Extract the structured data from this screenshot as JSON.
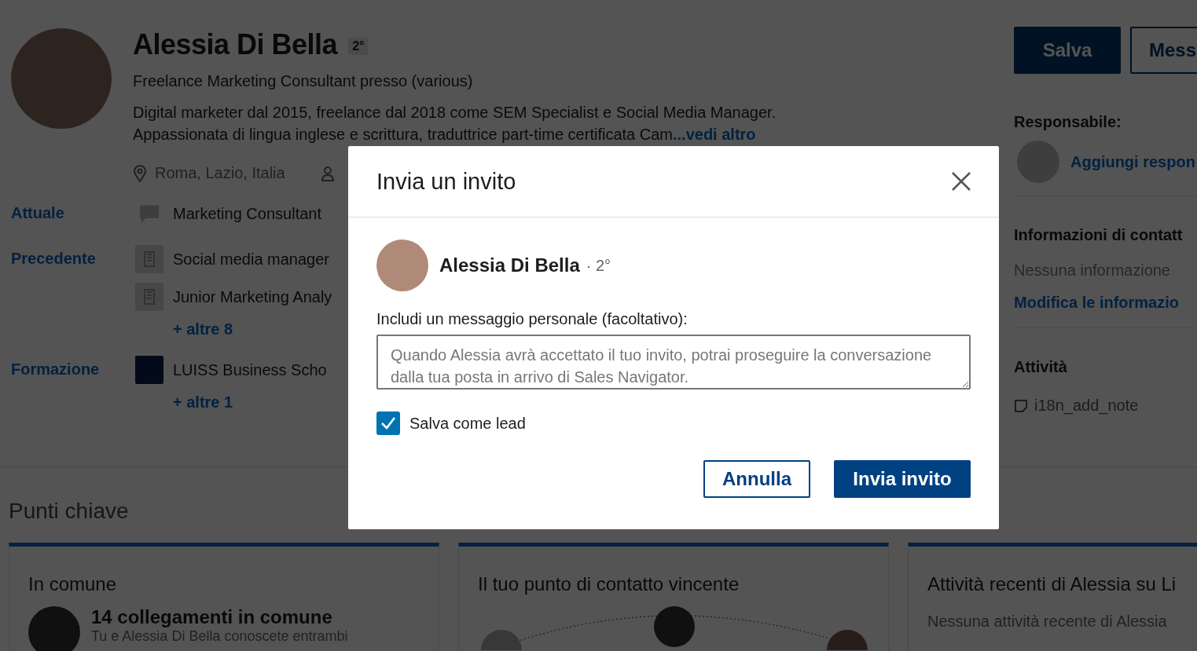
{
  "profile": {
    "name": "Alessia Di Bella",
    "degree": "2°",
    "headline": "Freelance Marketing Consultant presso (various)",
    "summary": [
      "Digital marketer dal 2015, freelance dal 2018 come SEM Specialist e Social Media Manager.",
      "Appassionata di lingua inglese e scrittura, traduttrice part-time certificata Cam"
    ],
    "summary_link": "...vedi altro",
    "location": "Roma, Lazio, Italia",
    "sections": [
      {
        "label": "Attuale",
        "entries": [
          {
            "kind": "bubble",
            "text": "Marketing Consultant"
          }
        ]
      },
      {
        "label": "Precedente",
        "entries": [
          {
            "kind": "building",
            "text": "Social media manager"
          },
          {
            "kind": "building",
            "text": "Junior Marketing Analy"
          }
        ],
        "more": "+ altre 8"
      },
      {
        "label": "Formazione",
        "entries": [
          {
            "kind": "school",
            "text": "LUISS Business Scho"
          }
        ],
        "more": "+ altre 1"
      }
    ]
  },
  "actions": [
    {
      "label": "Salva",
      "kind": "primary"
    },
    {
      "label": "Mess",
      "kind": "secondary"
    }
  ],
  "sidebar": {
    "owner_title": "Responsabile:",
    "owner_link": "Aggiungi respon",
    "contact_title": "Informazioni di contatt",
    "contact_empty": "Nessuna informazione",
    "contact_link": "Modifica le informazio",
    "activity_title": "Attività",
    "note": "i18n_add_note"
  },
  "highlights": {
    "title": "Punti chiave",
    "cards": [
      {
        "kind": "common",
        "title": "In comune",
        "headline": "14 collegamenti in comune",
        "text": "Tu e Alessia Di Bella conoscete entrambi"
      },
      {
        "kind": "path",
        "title": "Il tuo punto di contatto vincente"
      },
      {
        "kind": "activity",
        "title": "Attività recenti di Alessia su Li",
        "text": "Nessuna attività recente di Alessia"
      }
    ]
  },
  "dialog": {
    "title": "Invia un invito",
    "name": "Alessia Di Bella",
    "degree": "· 2°",
    "message_label": "Includi un messaggio personale (facoltativo):",
    "message_placeholder": "Quando Alessia avrà accettato il tuo invito, potrai proseguire la conversazione dalla tua posta in arrivo di Sales Navigator.",
    "save_lead": {
      "label": "Salva come lead",
      "checked": true
    },
    "buttons": [
      {
        "label": "Annulla",
        "kind": "secondary"
      },
      {
        "label": "Invia invito",
        "kind": "primary"
      }
    ]
  }
}
